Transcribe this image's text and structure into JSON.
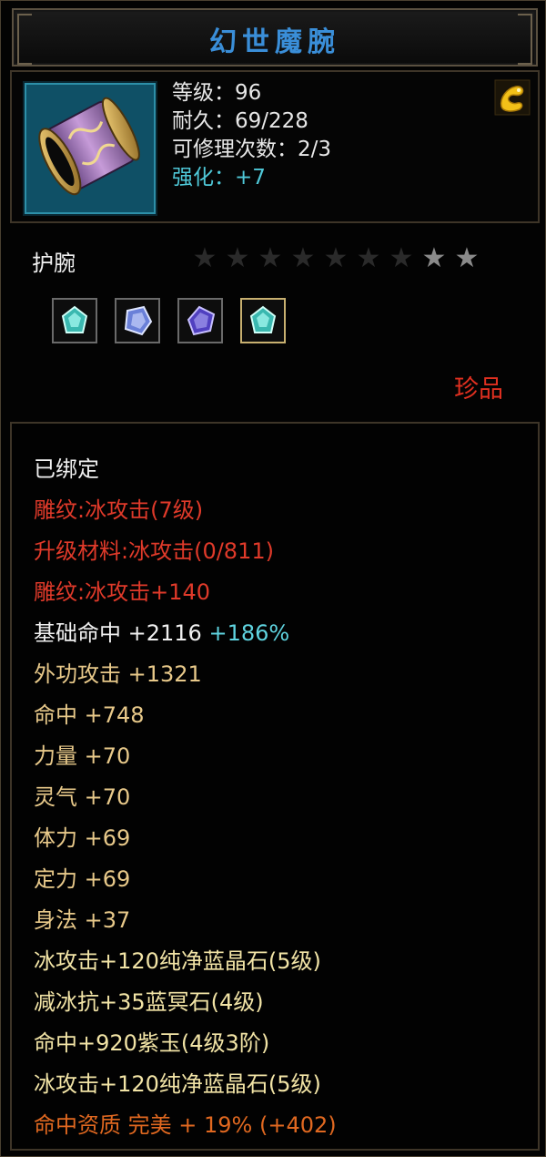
{
  "title": "幻世魔腕",
  "header": {
    "level_label": "等级：96",
    "durability_label": "耐久：69/228",
    "repair_label": "可修理次数：2/3",
    "enhance_label": "强化：+7"
  },
  "item_type": "护腕",
  "stars": {
    "total": 9,
    "lit": 2
  },
  "gems": [
    "gem-icon",
    "gem-icon",
    "gem-icon",
    "gem-icon"
  ],
  "rarity": "珍品",
  "details": {
    "bound": "已绑定",
    "engrave1": "雕纹:冰攻击(7级)",
    "upgrade_material": "升级材料:冰攻击(0/811)",
    "engrave2": "雕纹:冰攻击+140",
    "base_hit": "基础命中 +2116",
    "base_hit_bonus": "+186%",
    "ext_attack": "外功攻击 +1321",
    "hit": "命中 +748",
    "strength": "力量 +70",
    "spirit": "灵气 +70",
    "stamina": "体力 +69",
    "focus": "定力 +69",
    "agility": "身法 +37",
    "gem_line1": "冰攻击+120纯净蓝晶石(5级)",
    "gem_line2": "减冰抗+35蓝冥石(4级)",
    "gem_line3": "命中+920紫玉(4级3阶)",
    "gem_line4": "冰攻击+120纯净蓝晶石(5级)",
    "quality": "命中资质 完美 + 19% (+402)"
  },
  "colors": {
    "title": "#3a8ed8",
    "red": "#e03a2a",
    "gold": "#e8c98a",
    "cyan": "#5fd4e0",
    "orange": "#e06820"
  }
}
